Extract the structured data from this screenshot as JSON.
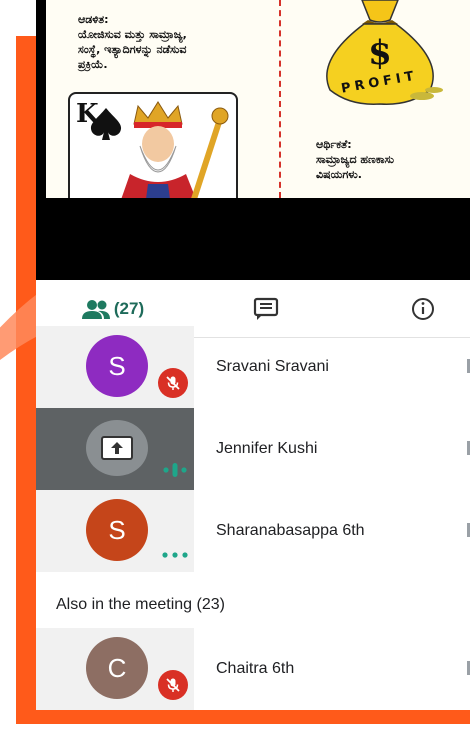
{
  "colors": {
    "frame_orange": "#ff5a1a",
    "accent_green": "#1e7a60",
    "mute_red": "#d93025",
    "speaking_teal": "#1ea68a"
  },
  "slide": {
    "left_heading": "ಆಡಳಿತ:",
    "left_body_line1": "ಯೋಜಿಸುವ ಮತ್ತು ಸಾಮ್ರಾಜ್ಯ,",
    "left_body_line2": "ಸಂಸ್ಥೆ, ಇತ್ಯಾದಿಗಳನ್ನು ನಡೆಸುವ",
    "left_body_line3": "ಪ್ರಕ್ರಿಯೆ.",
    "card_rank": "K",
    "bag_symbol": "$",
    "bag_word": "PROFIT",
    "right_heading": "ಆರ್ಥಿಕತೆ:",
    "right_body_line1": "ಸಾಮ್ರಾಜ್ಯದ ಹಣಕಾಸು",
    "right_body_line2": "ವಿಷಯಗಳು."
  },
  "tabs": {
    "people_icon": "people-icon",
    "people_count": "(27)",
    "chat_icon": "chat-icon",
    "info_icon": "info-icon"
  },
  "participants": [
    {
      "initial": "S",
      "name": "Sravani Sravani",
      "avatar_color": "#8e2bc1",
      "status": "muted"
    },
    {
      "initial": "",
      "name": "Jennifer Kushi",
      "avatar_color": "#8a8f92",
      "status": "speaking",
      "icon": "screen-share-icon"
    },
    {
      "initial": "S",
      "name": "Sharanabasappa 6th",
      "avatar_color": "#c5451a",
      "status": "more"
    }
  ],
  "also_section": {
    "heading": "Also in the meeting (23)",
    "participants": [
      {
        "initial": "C",
        "name": "Chaitra 6th",
        "avatar_color": "#8d6e63",
        "status": "muted"
      }
    ]
  }
}
